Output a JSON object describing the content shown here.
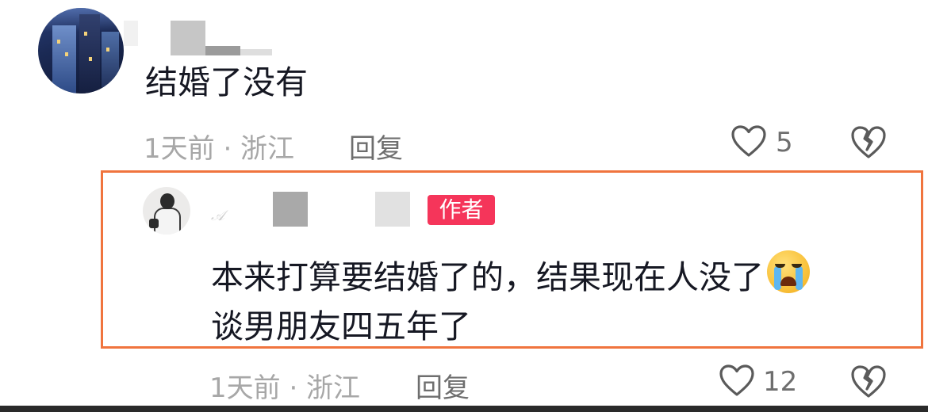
{
  "comments": [
    {
      "text": "结婚了没有",
      "meta": "1天前 · 浙江",
      "reply_label": "回复",
      "like_count": "5",
      "like_icon": "heart-outline-icon",
      "dislike_icon": "broken-heart-icon"
    },
    {
      "author_badge": "作者",
      "text_line1": "本来打算要结婚了的，结果现在人没了",
      "emoji": "crying-face-emoji",
      "text_line2": "谈男朋友四五年了",
      "meta": "1天前 · 浙江",
      "reply_label": "回复",
      "like_count": "12",
      "like_icon": "heart-outline-icon",
      "dislike_icon": "broken-heart-icon"
    }
  ],
  "colors": {
    "highlight_border": "#f0743e",
    "author_badge_bg": "#f5355a",
    "meta_text": "#a7a7a7",
    "icon_stroke": "#5a5a5a"
  }
}
